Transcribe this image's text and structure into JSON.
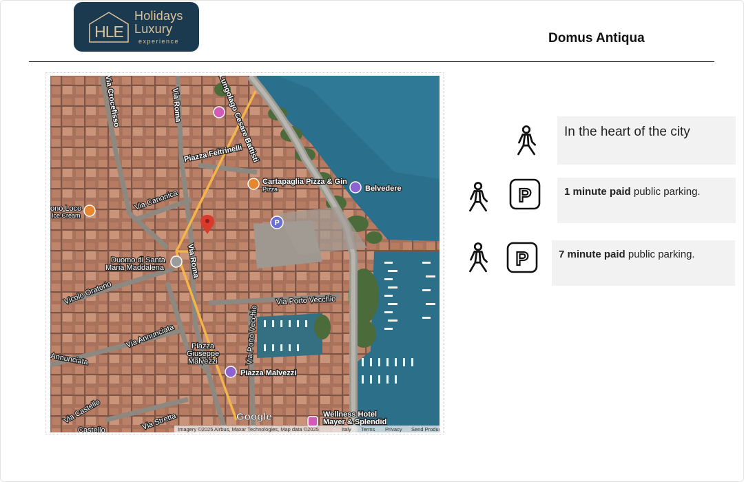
{
  "logo": {
    "monogram": "HLE",
    "line1": "Holidays",
    "line2": "Luxury",
    "line3": "experience"
  },
  "document": {
    "title": "Domus Antiqua"
  },
  "map": {
    "street_labels": {
      "via_crocefisso": "Via Crocefisso",
      "via_roma_top": "Via Roma",
      "lungolago": "Lungolago Cesare Battisti",
      "piazza_feltrinelli": "Piazza Feltrinelli",
      "via_canonica": "Via Canonica",
      "via_roma_mid": "Via Roma",
      "vicolo_oratorio": "Vicolo Oratorio",
      "via_porto_vecchio_h": "Via Porto Vecchio",
      "via_porto_vecchio_v": "Via Porto Vecchio",
      "via_annunciata": "Via Annunciata",
      "annunciata": "Annunciata",
      "via_castello": "Via Castello",
      "castello": "Castello",
      "via_stretta": "Via Stretta"
    },
    "places": {
      "cartapaglia_line1": "Cartapaglia Pizza & Gin",
      "cartapaglia_line2": "Pizza",
      "belvedere": "Belvedere",
      "loco_line1": "ono Loco",
      "loco_line2": "Ice Cream",
      "duomo_line1": "Duomo di Santa",
      "duomo_line2": "Maria Maddalena",
      "piazza_giuseppe_1": "Piazza",
      "piazza_giuseppe_2": "Giuseppe",
      "piazza_giuseppe_3": "Malvezzi",
      "piazza_malvezzi": "Piazza Malvezzi",
      "wellness_line1": "Wellness Hotel",
      "wellness_line2": "Mayer & Splendid"
    },
    "parking_marker": "P",
    "brand": "Google",
    "attribution": "Imagery ©2025 Airbus, Maxar Technologies, Map data ©2025",
    "footer_links": [
      "Italy",
      "Terms",
      "Privacy",
      "Send Product Feedback"
    ],
    "colors": {
      "route": "#f3b54a",
      "water": "#2a6f8c",
      "pin": "#d93a2b",
      "parking": "#6c6fd6",
      "poi_pink": "#d35bb8",
      "poi_purple": "#8e63cf",
      "poi_orange": "#e8862f"
    }
  },
  "cards": [
    {
      "text": "In the heart of the city",
      "icons": [
        "walking-person-icon"
      ]
    },
    {
      "bold": "1 minute paid",
      "rest": " public parking.",
      "icons": [
        "walking-person-icon",
        "parking-sign-icon"
      ]
    },
    {
      "bold": "7  minute paid",
      "rest": " public parking.",
      "icons": [
        "walking-person-icon",
        "parking-sign-icon"
      ]
    }
  ],
  "icon_glyphs": {
    "parking": "P"
  }
}
